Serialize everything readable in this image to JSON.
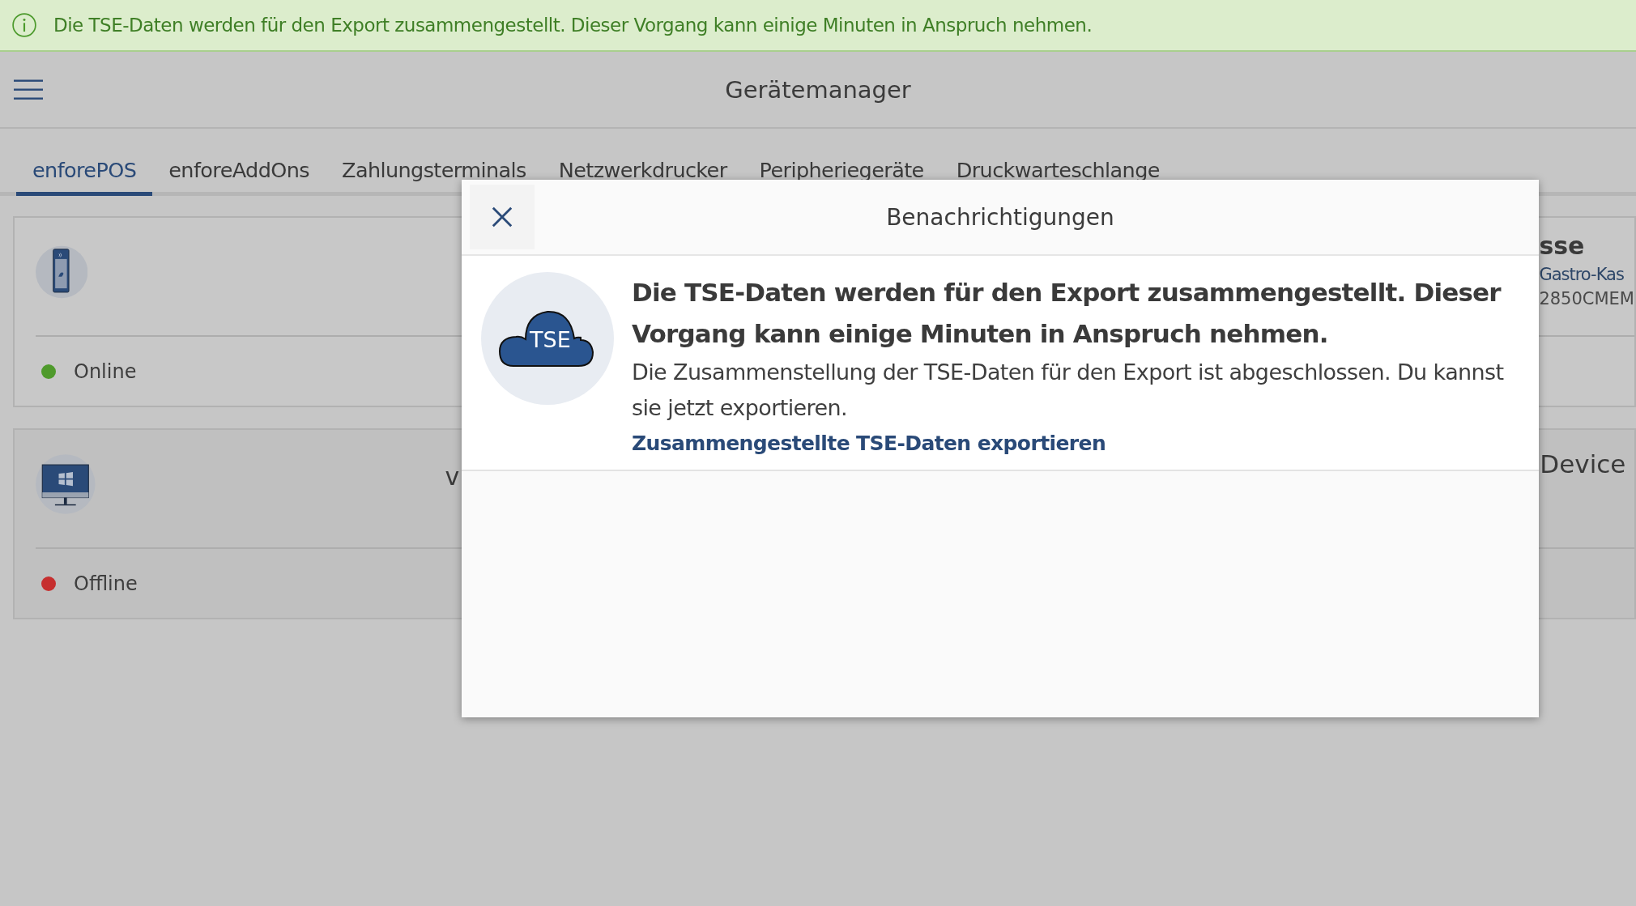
{
  "banner": {
    "text": "Die TSE-Daten werden für den Export zusammengestellt. Dieser Vorgang kann einige Minuten in Anspruch nehmen."
  },
  "header": {
    "title": "Gerätemanager"
  },
  "tabs": [
    {
      "label": "enforePOS",
      "selected": true
    },
    {
      "label": "enforeAddOns",
      "selected": false
    },
    {
      "label": "Zahlungsterminals",
      "selected": false
    },
    {
      "label": "Netzwerkdrucker",
      "selected": false
    },
    {
      "label": "Peripheriegeräte",
      "selected": false
    },
    {
      "label": "Druckwarteschlange",
      "selected": false
    }
  ],
  "devices": [
    {
      "kind": "terminal",
      "status": "Online",
      "color": "#4f9a2c",
      "title": "sse",
      "subtitle": "Gastro-Kas",
      "serial": "2850CMEM"
    },
    {
      "kind": "desktop",
      "status": "Offline",
      "color": "#c62f2f",
      "column_2": "v",
      "title": "Device"
    }
  ],
  "dialog": {
    "title": "Benachrichtigungen",
    "notifications": [
      {
        "icon_text": "TSE",
        "heading": "Die TSE-Daten werden für den Export zusammengestellt. Dieser Vorgang kann einige Minuten in Anspruch nehmen.",
        "body": "Die Zusammenstellung der TSE-Daten für den Export ist abgeschlossen. Du kannst sie jetzt exportieren.",
        "link": "Zusammengestellte TSE-Daten exportieren"
      }
    ]
  }
}
